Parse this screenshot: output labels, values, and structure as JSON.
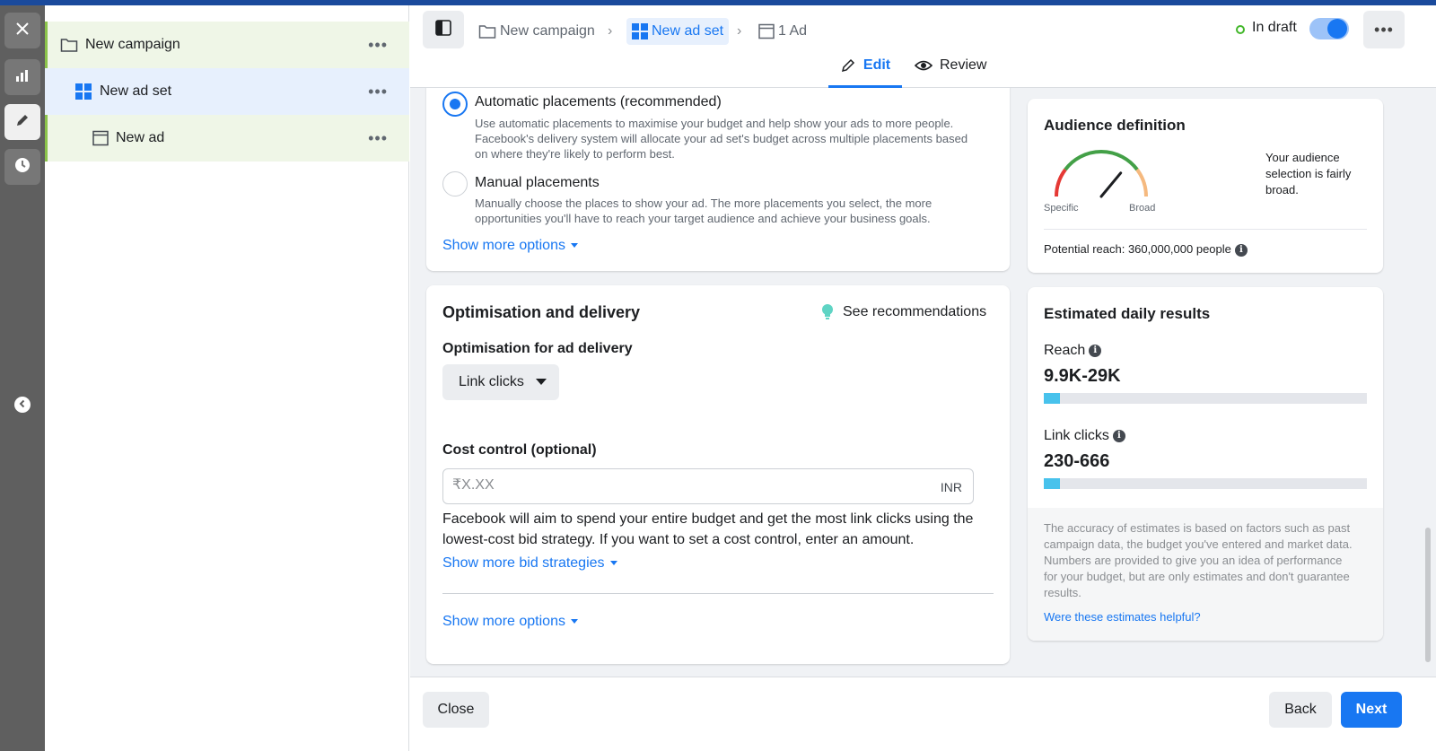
{
  "tree": {
    "items": [
      {
        "label": "New campaign",
        "icon": "folder-icon"
      },
      {
        "label": "New ad set",
        "icon": "grid-icon"
      },
      {
        "label": "New ad",
        "icon": "ad-frame-icon"
      }
    ]
  },
  "header": {
    "breadcrumb": {
      "campaign": "New campaign",
      "ad_set": "New ad set",
      "ad": "1 Ad"
    },
    "status": "In draft",
    "tabs": {
      "edit": "Edit",
      "review": "Review"
    }
  },
  "placements": {
    "automatic": {
      "title": "Automatic placements (recommended)",
      "desc_1": "Use automatic placements to maximise your budget and help show your ads to more people.",
      "desc_2": "Facebook's delivery system will allocate your ad set's budget across multiple placements based",
      "desc_3": "on where they're likely to perform best.",
      "selected": true
    },
    "manual": {
      "title": "Manual placements",
      "desc_1": "Manually choose the places to show your ad. The more placements you select, the more",
      "desc_2": "opportunities you'll have to reach your target audience and achieve your business goals.",
      "selected": false
    },
    "show_more": "Show more options"
  },
  "optimisation": {
    "title": "Optimisation and delivery",
    "recommendations": "See recommendations",
    "delivery_label": "Optimisation for ad delivery",
    "delivery_value": "Link clicks",
    "cost_label": "Cost control (optional)",
    "cost_placeholder": "₹X.XX",
    "currency": "INR",
    "help_1": "Facebook will aim to spend your entire budget and get the most link clicks using the",
    "help_2": "lowest-cost bid strategy. If you want to set a cost control, enter an amount.",
    "bid_link": "Show more bid strategies",
    "show_more": "Show more options"
  },
  "audience": {
    "title": "Audience definition",
    "gauge_specific": "Specific",
    "gauge_broad": "Broad",
    "summary_1": "Your audience",
    "summary_2": "selection is fairly",
    "summary_3": "broad.",
    "reach": "Potential reach: 360,000,000 people",
    "gauge_level": 0.72
  },
  "estimates": {
    "title": "Estimated daily results",
    "reach_label": "Reach",
    "reach_value": "9.9K-29K",
    "reach_fill": 0.05,
    "clicks_label": "Link clicks",
    "clicks_value": "230-666",
    "clicks_fill": 0.05,
    "note_1": "The accuracy of estimates is based on factors such as past",
    "note_2": "campaign data, the budget you've entered and market data.",
    "note_3": "Numbers are provided to give you an idea of performance",
    "note_4": "for your budget, but are only estimates and don't guarantee",
    "note_5": "results.",
    "feedback": "Were these estimates helpful?"
  },
  "footer": {
    "close": "Close",
    "back": "Back",
    "next": "Next"
  },
  "colors": {
    "accent": "#1877f2",
    "draft_status": "#42b72a",
    "bar_fill": "#48c2ec"
  }
}
